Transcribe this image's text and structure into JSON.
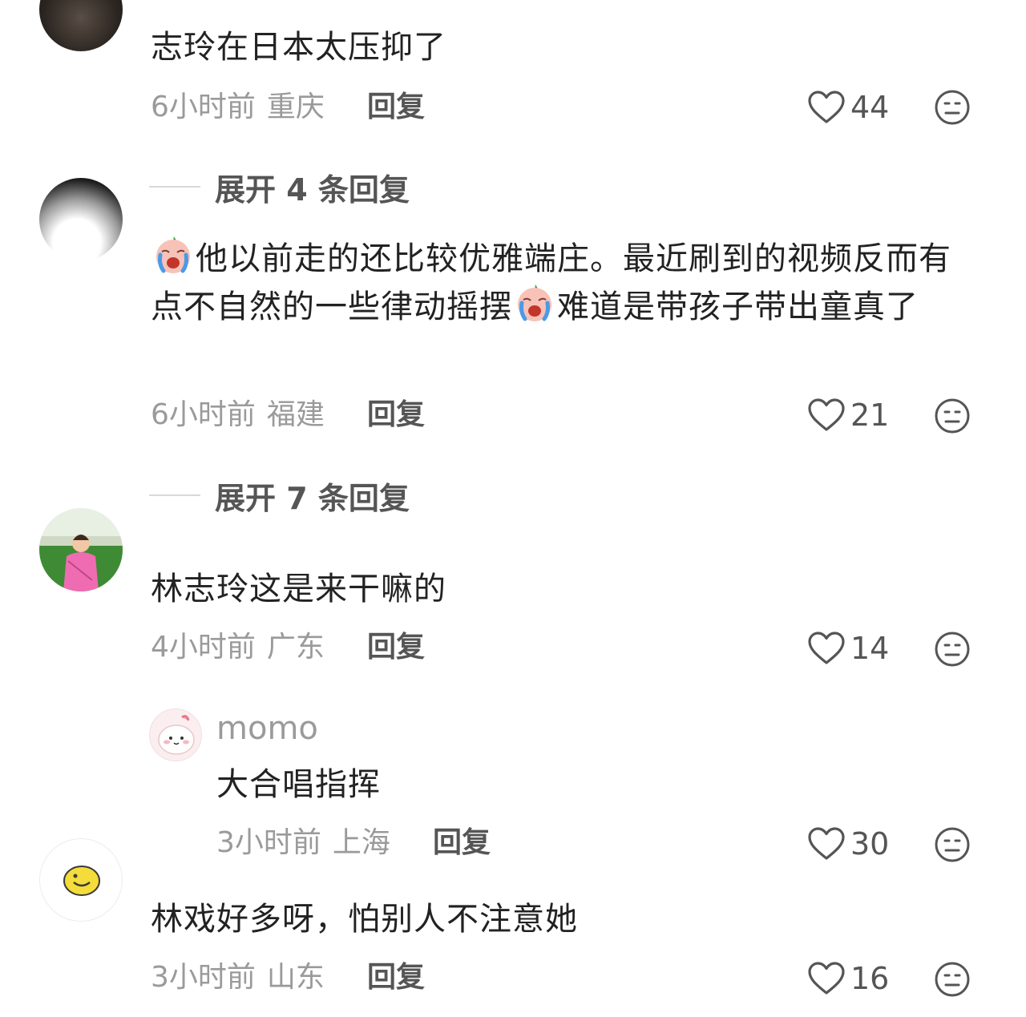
{
  "comments": [
    {
      "text": "志玲在日本太压抑了",
      "time": "6小时前",
      "location": "重庆",
      "reply_label": "回复",
      "likes": "44",
      "expand_label": "展开 4 条回复"
    },
    {
      "text_part1": "他以前走的还比较优雅端庄。最近刷到的视频反而有点不自然的一些律动摇摆",
      "text_part2": "难道是带孩子带出童真了",
      "time": "6小时前",
      "location": "福建",
      "reply_label": "回复",
      "likes": "21",
      "expand_label": "展开 7 条回复"
    },
    {
      "text": "林志玲这是来干嘛的",
      "time": "4小时前",
      "location": "广东",
      "reply_label": "回复",
      "likes": "14",
      "reply": {
        "username": "momo",
        "text": "大合唱指挥",
        "time": "3小时前",
        "location": "上海",
        "reply_label": "回复",
        "likes": "30"
      }
    },
    {
      "text": "林戏好多呀，怕别人不注意她",
      "time": "3小时前",
      "location": "山东",
      "reply_label": "回复",
      "likes": "16"
    }
  ],
  "icons": {
    "like": "heart-outline-icon",
    "dislike": "neutral-face-icon",
    "inline_emoji": "crying-face-emoji"
  },
  "colors": {
    "text": "#222222",
    "meta": "#9a9a9a",
    "action": "#555555"
  }
}
